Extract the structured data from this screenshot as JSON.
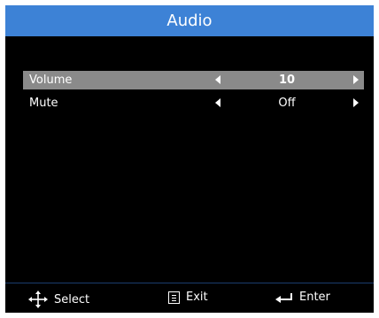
{
  "title": "Audio",
  "rows": [
    {
      "label": "Volume",
      "value": "10",
      "selected": true
    },
    {
      "label": "Mute",
      "value": "Off",
      "selected": false
    }
  ],
  "footer": {
    "select_label": "Select",
    "exit_label": "Exit",
    "enter_label": "Enter"
  },
  "colors": {
    "title_bar": "#3d82d6",
    "selected_row": "#8a8a8a",
    "background": "#000000"
  },
  "icons": [
    "four-way-arrows-icon",
    "menu-icon",
    "return-arrow-icon"
  ]
}
